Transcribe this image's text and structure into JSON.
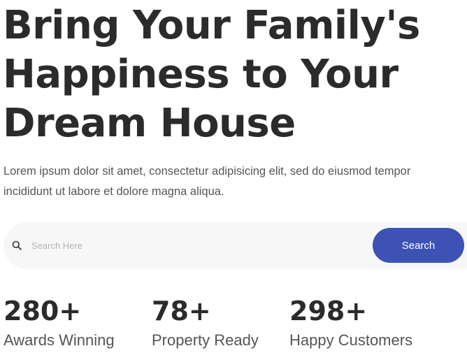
{
  "hero": {
    "title_lines": [
      "Bring Your Family's",
      "Happiness to Your",
      "Dream House"
    ],
    "subtitle_lines": [
      "Lorem ipsum dolor sit amet, consectetur adipisicing elit, sed do eiusmod tempor",
      "incididunt ut labore et dolore magna aliqua."
    ]
  },
  "search": {
    "icon": "search-icon",
    "placeholder": "Search Here",
    "value": "",
    "button_label": "Search",
    "button_color": "#3e52b6"
  },
  "stats": [
    {
      "value": "280+",
      "label": "Awards Winning"
    },
    {
      "value": "78+",
      "label": "Property Ready"
    },
    {
      "value": "298+",
      "label": "Happy Customers"
    }
  ]
}
